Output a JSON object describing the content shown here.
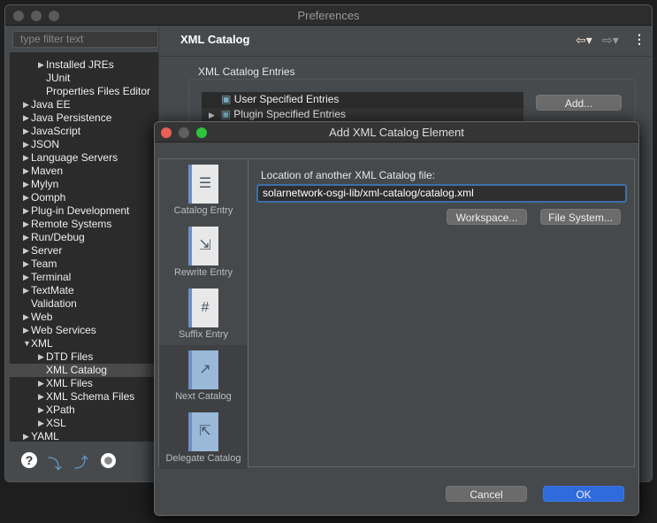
{
  "preferences": {
    "title": "Preferences",
    "filter_placeholder": "type filter text",
    "page_title": "XML Catalog",
    "section_label": "XML Catalog Entries",
    "entries": [
      "User Specified Entries",
      "Plugin Specified Entries"
    ],
    "add_button": "Add...",
    "tree": [
      {
        "label": "Installed JREs",
        "level": 1,
        "arrow": "right"
      },
      {
        "label": "JUnit",
        "level": 1,
        "arrow": ""
      },
      {
        "label": "Properties Files Editor",
        "level": 1,
        "arrow": ""
      },
      {
        "label": "Java EE",
        "level": 0,
        "arrow": "right"
      },
      {
        "label": "Java Persistence",
        "level": 0,
        "arrow": "right"
      },
      {
        "label": "JavaScript",
        "level": 0,
        "arrow": "right"
      },
      {
        "label": "JSON",
        "level": 0,
        "arrow": "right"
      },
      {
        "label": "Language Servers",
        "level": 0,
        "arrow": "right"
      },
      {
        "label": "Maven",
        "level": 0,
        "arrow": "right"
      },
      {
        "label": "Mylyn",
        "level": 0,
        "arrow": "right"
      },
      {
        "label": "Oomph",
        "level": 0,
        "arrow": "right"
      },
      {
        "label": "Plug-in Development",
        "level": 0,
        "arrow": "right"
      },
      {
        "label": "Remote Systems",
        "level": 0,
        "arrow": "right"
      },
      {
        "label": "Run/Debug",
        "level": 0,
        "arrow": "right"
      },
      {
        "label": "Server",
        "level": 0,
        "arrow": "right"
      },
      {
        "label": "Team",
        "level": 0,
        "arrow": "right"
      },
      {
        "label": "Terminal",
        "level": 0,
        "arrow": "right"
      },
      {
        "label": "TextMate",
        "level": 0,
        "arrow": "right"
      },
      {
        "label": "Validation",
        "level": 0,
        "arrow": ""
      },
      {
        "label": "Web",
        "level": 0,
        "arrow": "right"
      },
      {
        "label": "Web Services",
        "level": 0,
        "arrow": "right"
      },
      {
        "label": "XML",
        "level": 0,
        "arrow": "down"
      },
      {
        "label": "DTD Files",
        "level": 1,
        "arrow": "right"
      },
      {
        "label": "XML Catalog",
        "level": 1,
        "arrow": "",
        "selected": true
      },
      {
        "label": "XML Files",
        "level": 1,
        "arrow": "right"
      },
      {
        "label": "XML Schema Files",
        "level": 1,
        "arrow": "right"
      },
      {
        "label": "XPath",
        "level": 1,
        "arrow": "right"
      },
      {
        "label": "XSL",
        "level": 1,
        "arrow": "right"
      },
      {
        "label": "YAML",
        "level": 0,
        "arrow": "right"
      }
    ]
  },
  "dialog": {
    "title": "Add XML Catalog Element",
    "entry_types": [
      "Catalog Entry",
      "Rewrite Entry",
      "Suffix Entry",
      "Next Catalog",
      "Delegate Catalog"
    ],
    "location_label": "Location of another XML Catalog file:",
    "location_value": "solarnetwork-osgi-lib/xml-catalog/catalog.xml",
    "workspace_button": "Workspace...",
    "filesystem_button": "File System...",
    "cancel_button": "Cancel",
    "ok_button": "OK"
  },
  "colors": {
    "accent": "#2f6bdb",
    "close": "#ec5f57",
    "minimize": "#5f5f5f",
    "zoom": "#2fc440"
  }
}
